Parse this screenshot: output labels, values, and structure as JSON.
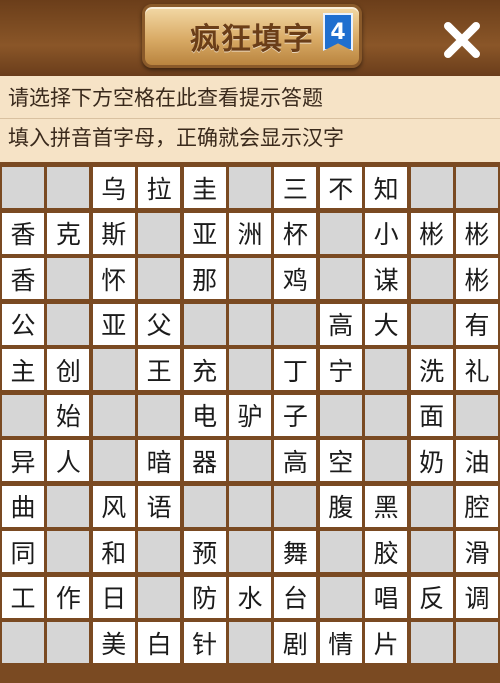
{
  "header": {
    "title": "疯狂填字",
    "level": "4",
    "close_icon": "close-icon"
  },
  "hints": {
    "line1": "请选择下方空格在此查看提示答题",
    "line2": "填入拼音首字母，正确就会显示汉字"
  },
  "colors": {
    "frame": "#7a4a22",
    "hint_bg": "#f6e3c6",
    "blank_cell": "#d6d6d6",
    "filled_cell": "#ffffff",
    "badge": "#1f6fcf"
  },
  "grid": {
    "rows": 11,
    "cols": 11,
    "cells": [
      [
        "",
        "",
        "乌",
        "拉",
        "圭",
        "",
        "三",
        "不",
        "知",
        "",
        ""
      ],
      [
        "香",
        "克",
        "斯",
        "",
        "亚",
        "洲",
        "杯",
        "",
        "小",
        "彬",
        "彬"
      ],
      [
        "香",
        "",
        "怀",
        "",
        "那",
        "",
        "鸡",
        "",
        "谋",
        "",
        "彬"
      ],
      [
        "公",
        "",
        "亚",
        "父",
        "",
        "",
        "",
        "高",
        "大",
        "",
        "有"
      ],
      [
        "主",
        "创",
        "",
        "王",
        "充",
        "",
        "丁",
        "宁",
        "",
        "洗",
        "礼"
      ],
      [
        "",
        "始",
        "",
        "",
        "电",
        "驴",
        "子",
        "",
        "",
        "面",
        ""
      ],
      [
        "异",
        "人",
        "",
        "暗",
        "器",
        "",
        "高",
        "空",
        "",
        "奶",
        "油"
      ],
      [
        "曲",
        "",
        "风",
        "语",
        "",
        "",
        "",
        "腹",
        "黑",
        "",
        "腔"
      ],
      [
        "同",
        "",
        "和",
        "",
        "预",
        "",
        "舞",
        "",
        "胶",
        "",
        "滑"
      ],
      [
        "工",
        "作",
        "日",
        "",
        "防",
        "水",
        "台",
        "",
        "唱",
        "反",
        "调"
      ],
      [
        "",
        "",
        "美",
        "白",
        "针",
        "",
        "剧",
        "情",
        "片",
        "",
        ""
      ]
    ]
  }
}
